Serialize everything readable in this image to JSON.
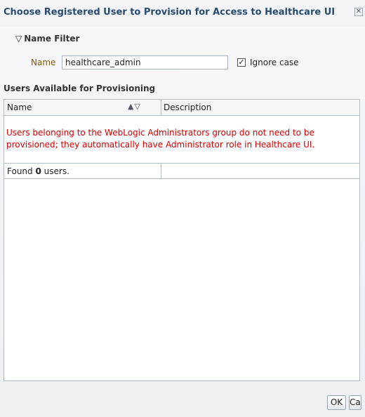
{
  "dialog": {
    "title": "Choose Registered User to Provision for Access to Healthcare UI"
  },
  "filter": {
    "section_title": "Name Filter",
    "name_label": "Name",
    "name_value": "healthcare_admin",
    "ignore_case_label": "Ignore case",
    "ignore_case_checked": true
  },
  "users": {
    "section_title": "Users Available for Provisioning",
    "columns": [
      "Name",
      "Description"
    ],
    "message": "Users belonging to the WebLogic Administrators group do not need to be provisioned; they automatically have Administrator role in Healthcare UI.",
    "found_prefix": "Found ",
    "found_count": "0",
    "found_suffix": " users."
  },
  "buttons": {
    "ok": "OK",
    "cancel": "Cancel"
  }
}
